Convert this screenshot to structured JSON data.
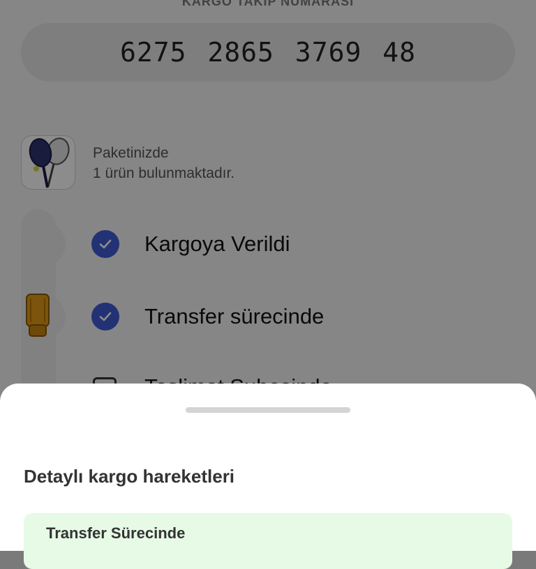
{
  "tracking": {
    "label": "KARGO TAKİP NUMARASI",
    "number": "6275 2865 3769 48"
  },
  "package": {
    "line1": "Paketinizde",
    "line2": "1 ürün bulunmaktadır."
  },
  "timeline": {
    "steps": [
      {
        "label": "Kargoya Verildi",
        "status": "done"
      },
      {
        "label": "Transfer sürecinde",
        "status": "done"
      },
      {
        "label": "Teslimat Şubesinde",
        "status": "pending"
      }
    ]
  },
  "sheet": {
    "title": "Detaylı kargo hareketleri",
    "events": [
      {
        "title": "Transfer Sürecinde"
      }
    ]
  },
  "icons": {
    "check": "check-icon",
    "courier": "courier-backpack-icon",
    "product": "tennis-rackets-thumbnail"
  },
  "colors": {
    "check": "#3e5bd6",
    "event_card": "#e6fae6",
    "overlay": "rgba(0,0,0,0.45)"
  }
}
